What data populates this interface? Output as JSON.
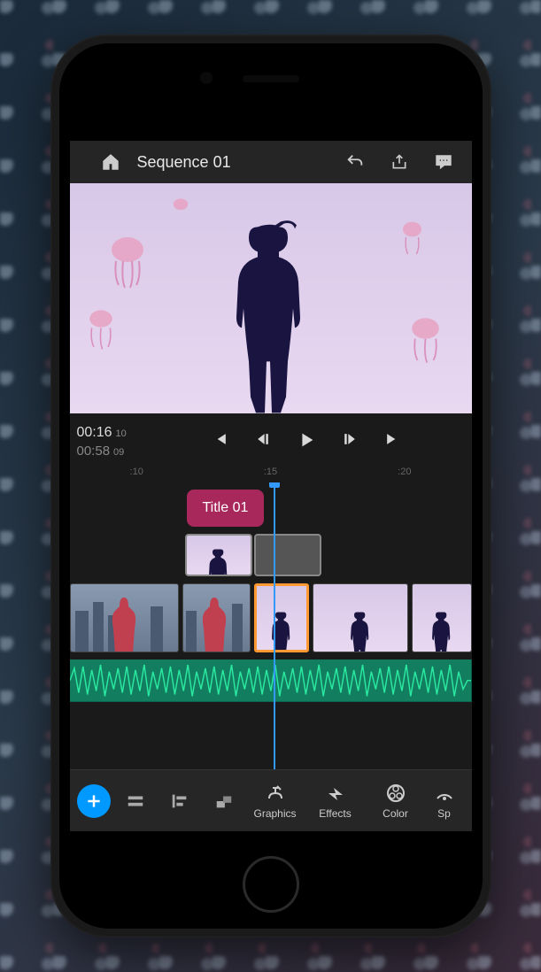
{
  "header": {
    "title": "Sequence 01"
  },
  "playback": {
    "current_time": "00:16",
    "current_frames": "10",
    "total_time": "00:58",
    "total_frames": "09"
  },
  "ruler": {
    "tick1": ":10",
    "tick2": ":15",
    "tick3": ":20"
  },
  "timeline": {
    "title_clip_label": "Title 01"
  },
  "tabs": {
    "graphics": "Graphics",
    "effects": "Effects",
    "color": "Color",
    "speed": "Sp"
  }
}
